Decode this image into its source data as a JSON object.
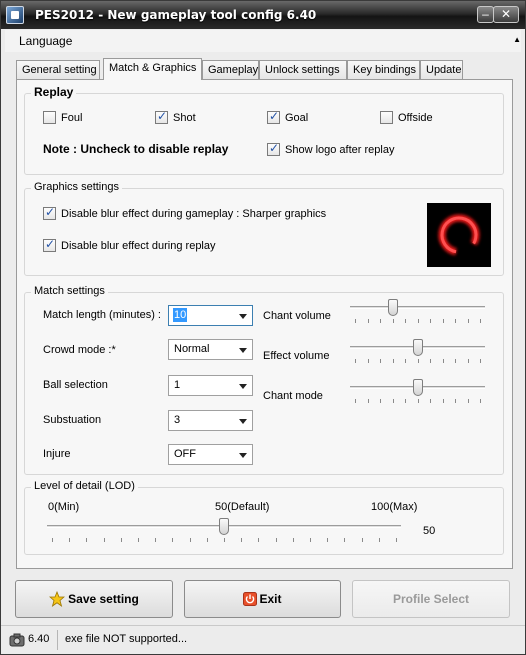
{
  "window": {
    "title": "PES2012 - New gameplay tool config 6.40"
  },
  "menu": {
    "language": "Language"
  },
  "tabs": [
    "General setting",
    "Match & Graphics",
    "Gameplay",
    "Unlock settings",
    "Key bindings",
    "Update"
  ],
  "replay": {
    "title": "Replay",
    "foul": "Foul",
    "shot": "Shot",
    "goal": "Goal",
    "offside": "Offside",
    "note": "Note : Uncheck to disable replay",
    "show_logo": "Show logo after replay"
  },
  "graphics": {
    "title": "Graphics settings",
    "blur_gameplay": "Disable blur effect during gameplay : Sharper graphics",
    "blur_replay": "Disable blur effect during replay"
  },
  "match": {
    "title": "Match settings",
    "match_length_label": "Match length (minutes) :",
    "match_length_value": "10",
    "crowd_mode_label": "Crowd mode :*",
    "crowd_mode_value": "Normal",
    "ball_selection_label": "Ball selection",
    "ball_selection_value": "1",
    "substitution_label": "Substuation",
    "substitution_value": "3",
    "injure_label": "Injure",
    "injure_value": "OFF",
    "chant_volume_label": "Chant volume",
    "effect_volume_label": "Effect volume",
    "chant_mode_label": "Chant mode",
    "chant_volume_level": 0.3,
    "effect_volume_level": 0.5,
    "chant_mode_level": 0.5
  },
  "lod": {
    "title": "Level of detail (LOD)",
    "min_label": "0(Min)",
    "default_label": "50(Default)",
    "max_label": "100(Max)",
    "value": "50",
    "level": 0.5
  },
  "buttons": {
    "save": "Save setting",
    "exit": "Exit",
    "profile": "Profile Select"
  },
  "status": {
    "version": "6.40",
    "message": "exe file NOT supported..."
  },
  "colors": {
    "accent": "#3399ff",
    "title_bar": "#1f1f1f"
  }
}
